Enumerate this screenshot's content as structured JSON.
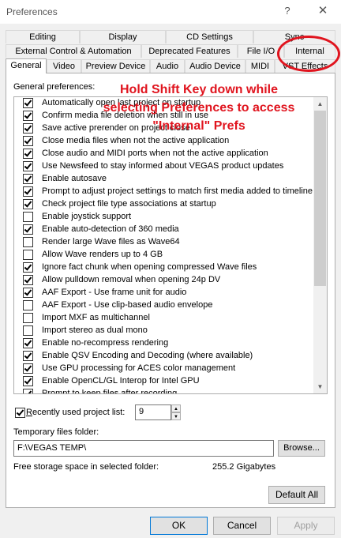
{
  "window": {
    "title": "Preferences",
    "help_glyph": "?",
    "close_glyph": "✕"
  },
  "tabs_row1": [
    "Editing",
    "Display",
    "CD Settings",
    "Sync"
  ],
  "tabs_row2": [
    "External Control & Automation",
    "Deprecated Features",
    "File I/O",
    "Internal"
  ],
  "tabs_row3": [
    "General",
    "Video",
    "Preview Device",
    "Audio",
    "Audio Device",
    "MIDI",
    "VST Effects"
  ],
  "active_tab": "General",
  "general": {
    "label": "General preferences:",
    "items": [
      {
        "label": "Automatically open last project on startup",
        "checked": true
      },
      {
        "label": "Confirm media file deletion when still in use",
        "checked": true
      },
      {
        "label": "Save active prerender on project close",
        "checked": true
      },
      {
        "label": "Close media files when not the active application",
        "checked": true
      },
      {
        "label": "Close audio and MIDI ports when not the active application",
        "checked": true
      },
      {
        "label": "Use Newsfeed to stay informed about VEGAS product updates",
        "checked": true
      },
      {
        "label": "Enable autosave",
        "checked": true
      },
      {
        "label": "Prompt to adjust project settings to match first media added to timeline",
        "checked": true
      },
      {
        "label": "Check project file type associations at startup",
        "checked": true
      },
      {
        "label": "Enable joystick support",
        "checked": false
      },
      {
        "label": "Enable auto-detection of 360 media",
        "checked": true
      },
      {
        "label": "Render large Wave files as Wave64",
        "checked": false
      },
      {
        "label": "Allow Wave renders up to 4 GB",
        "checked": false
      },
      {
        "label": "Ignore fact chunk when opening compressed Wave files",
        "checked": true
      },
      {
        "label": "Allow pulldown removal when opening 24p DV",
        "checked": true
      },
      {
        "label": "AAF Export - Use frame unit for audio",
        "checked": true
      },
      {
        "label": "AAF Export - Use clip-based audio envelope",
        "checked": false
      },
      {
        "label": "Import MXF as multichannel",
        "checked": false
      },
      {
        "label": "Import stereo as dual mono",
        "checked": false
      },
      {
        "label": "Enable no-recompress rendering",
        "checked": true
      },
      {
        "label": "Enable QSV Encoding and Decoding (where available)",
        "checked": true
      },
      {
        "label": "Use GPU processing for ACES color management",
        "checked": true
      },
      {
        "label": "Enable OpenCL/GL Interop for Intel GPU",
        "checked": true
      },
      {
        "label": "Prompt to keep files after recording",
        "checked": true
      }
    ]
  },
  "annotation": "Hold Shift Key down while selecting Preferences to access \"Internal\" Prefs",
  "recent": {
    "label_underlined": "R",
    "label_rest": "ecently used project list:",
    "checked": true,
    "value": "9"
  },
  "temp": {
    "label": "Temporary files folder:",
    "value": "F:\\VEGAS TEMP\\",
    "browse": "Browse..."
  },
  "free": {
    "label": "Free storage space in selected folder:",
    "value": "255.2 Gigabytes"
  },
  "buttons": {
    "default_all": "Default All",
    "ok": "OK",
    "cancel": "Cancel",
    "apply": "Apply"
  },
  "colors": {
    "annotation": "#e0141e",
    "accent": "#0078d7"
  }
}
